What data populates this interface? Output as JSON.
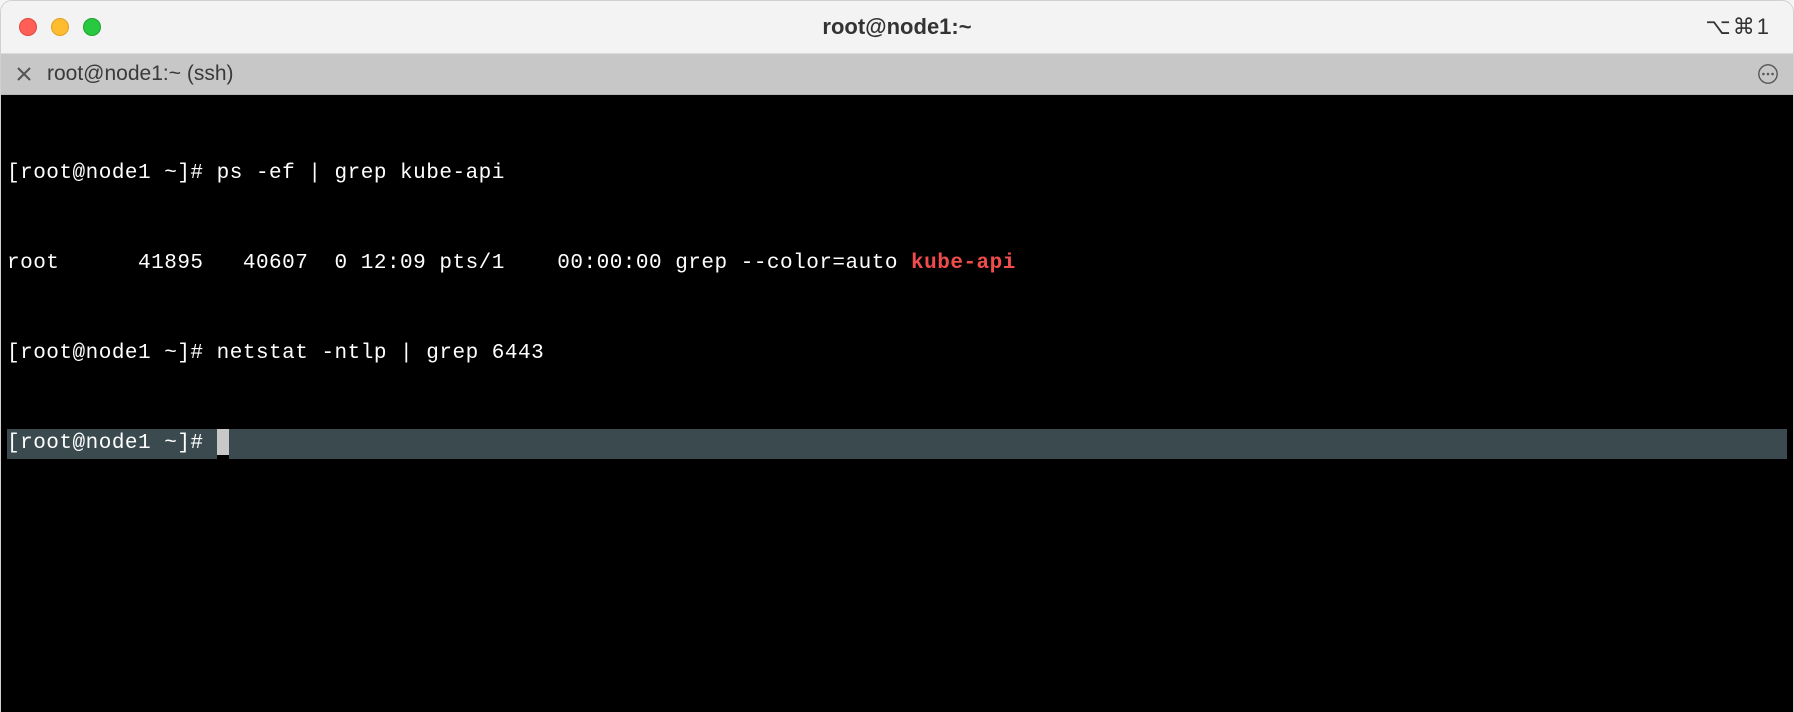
{
  "window": {
    "title": "root@node1:~",
    "indicator": "⌥⌘1"
  },
  "tab": {
    "label": "root@node1:~ (ssh)"
  },
  "terminal": {
    "prompt": "[root@node1 ~]#",
    "lines": [
      {
        "prompt": "[root@node1 ~]#",
        "command": " ps -ef | grep kube-api"
      },
      {
        "output_pre": "root      41895   40607  0 12:09 pts/1    00:00:00 grep --color=auto ",
        "output_hl": "kube-api"
      },
      {
        "prompt": "[root@node1 ~]#",
        "command": " netstat -ntlp | grep 6443"
      }
    ],
    "active_prompt": "[root@node1 ~]# "
  }
}
